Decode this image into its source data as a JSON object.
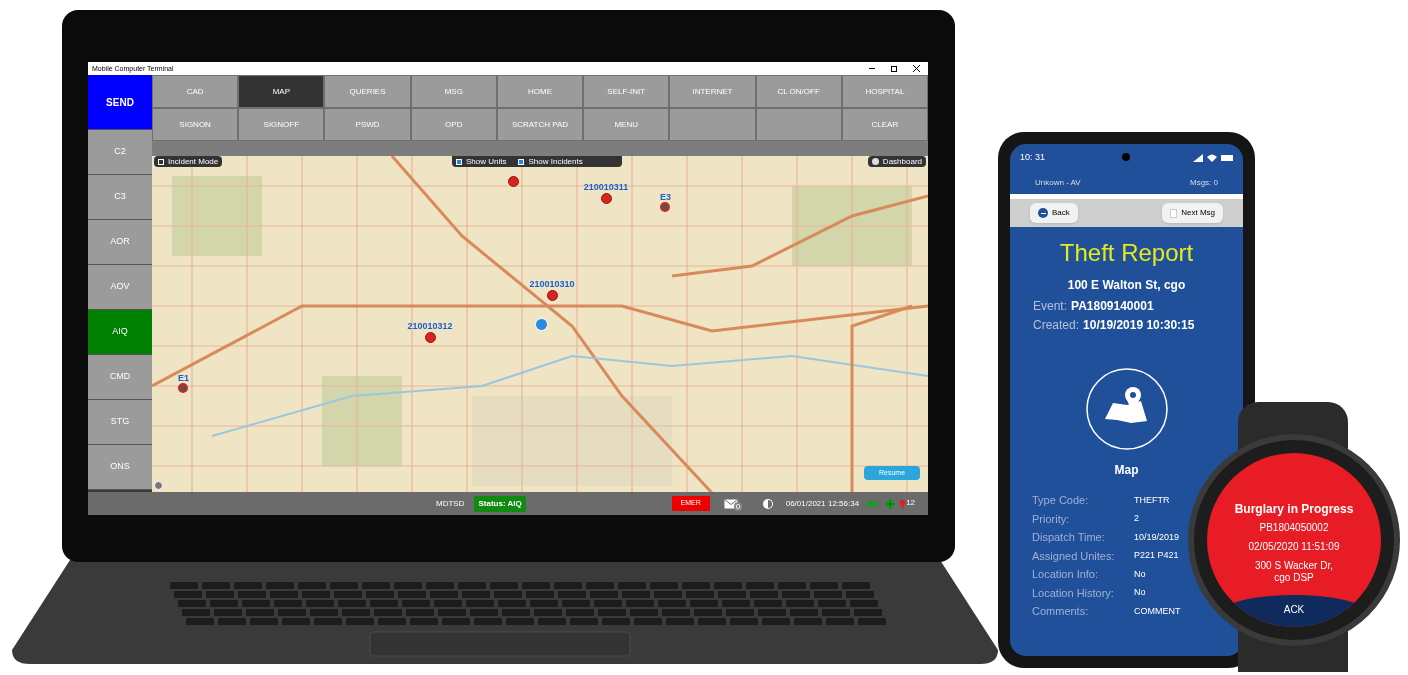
{
  "laptop": {
    "window": {
      "title": "Mobile Computer Terminal"
    },
    "side_buttons": [
      {
        "label": "SEND",
        "color": "#0000ff"
      },
      {
        "label": "C2",
        "color": "#9b9b9b"
      },
      {
        "label": "C3",
        "color": "#9b9b9b"
      },
      {
        "label": "AOR",
        "color": "#9b9b9b"
      },
      {
        "label": "AOV",
        "color": "#9b9b9b"
      },
      {
        "label": "AIQ",
        "color": "#008000"
      },
      {
        "label": "CMD",
        "color": "#9b9b9b"
      },
      {
        "label": "STG",
        "color": "#9b9b9b"
      },
      {
        "label": "ONS",
        "color": "#9b9b9b"
      }
    ],
    "toolbar_rows": [
      [
        {
          "label": "CAD",
          "selected": false
        },
        {
          "label": "MAP",
          "selected": true
        },
        {
          "label": "QUERIES",
          "selected": false
        },
        {
          "label": "MSG",
          "selected": false
        },
        {
          "label": "HOME",
          "selected": false
        },
        {
          "label": "SELF-INIT",
          "selected": false
        },
        {
          "label": "INTERNET",
          "selected": false
        },
        {
          "label": "CL ON/OFF",
          "selected": false
        },
        {
          "label": "HOSPITAL",
          "selected": false
        }
      ],
      [
        {
          "label": "SIGNON",
          "selected": false
        },
        {
          "label": "SIGNOFF",
          "selected": false
        },
        {
          "label": "PSWD",
          "selected": false
        },
        {
          "label": "OPD",
          "selected": false
        },
        {
          "label": "SCRATCH PAD",
          "selected": false
        },
        {
          "label": "MENU",
          "selected": false
        },
        {
          "selected": false
        },
        {
          "selected": false
        },
        {
          "label": "CLEAR",
          "selected": false
        }
      ]
    ],
    "map": {
      "toggles": [
        {
          "label": "Incident Mode",
          "checked": false
        },
        {
          "label": "Show Units",
          "checked": true
        },
        {
          "label": "Show Incidents",
          "checked": true
        }
      ],
      "dashboard_button": "Dashboard",
      "incidents": [
        {
          "kind": "marker"
        },
        {
          "kind": "labeled",
          "label": "210010311"
        },
        {
          "kind": "labeled",
          "label": "210010310"
        },
        {
          "kind": "labeled",
          "label": "210010312"
        }
      ],
      "units": [
        {
          "label": "E3"
        },
        {
          "label": "E1"
        }
      ],
      "resume_button": "Resume"
    },
    "status_bar": {
      "station": "MDTSD",
      "status": "Status: AIQ",
      "emer_button": "EMER",
      "mail_count": "0",
      "datetime": "06/01/2021 12:56:34",
      "alert_count": "12"
    }
  },
  "phone": {
    "time": "10: 31",
    "unit": "Unkown - AV",
    "messages": "Msgs: 0",
    "back_button": "Back",
    "next_button": "Next Msg",
    "title": "Theft Report",
    "address": "100 E Walton St, cgo",
    "summary": [
      {
        "label": "Event:",
        "value": "PA1809140001"
      },
      {
        "label": "Created:",
        "value": "10/19/2019 10:30:15"
      }
    ],
    "map_label": "Map",
    "fields": [
      {
        "label": "Type Code:",
        "value": "THEFTR"
      },
      {
        "label": "Priority:",
        "value": "2"
      },
      {
        "label": "Dispatch Time:",
        "value": "10/19/2019"
      },
      {
        "label": "Assigned Unites:",
        "value": "P221 P421"
      },
      {
        "label": "Location Info:",
        "value": "No"
      },
      {
        "label": "Location History:",
        "value": "No"
      },
      {
        "label": "Comments:",
        "value": "COMMENT"
      }
    ]
  },
  "watch": {
    "title": "Burglary in Progress",
    "event": "PB1804050002",
    "datetime": "02/05/2020 11:51:09",
    "address": "300 S Wacker Dr, cgo DSP",
    "ack_button": "ACK"
  }
}
